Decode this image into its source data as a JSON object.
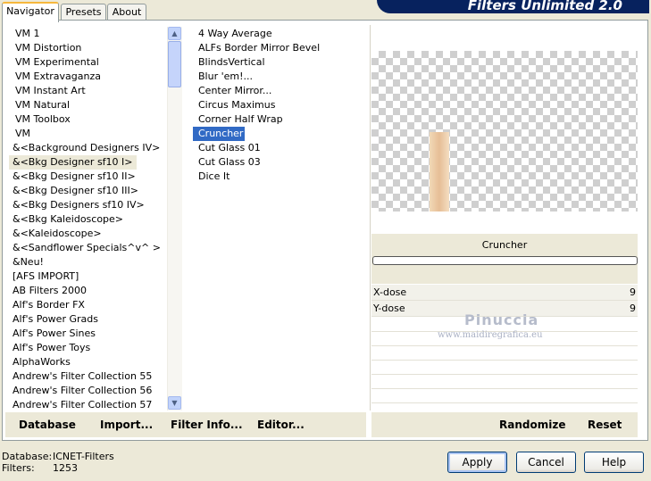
{
  "tabs": [
    {
      "label": "Navigator"
    },
    {
      "label": "Presets"
    },
    {
      "label": "About"
    }
  ],
  "header": {
    "title": "Filters Unlimited 2.0"
  },
  "categories": [
    "VM 1",
    "VM Distortion",
    "VM Experimental",
    "VM Extravaganza",
    "VM Instant Art",
    "VM Natural",
    "VM Toolbox",
    "VM",
    "&<Background Designers IV>",
    "&<Bkg Designer sf10 I>",
    "&<Bkg Designer sf10 II>",
    "&<Bkg Designer sf10 III>",
    "&<Bkg Designers sf10 IV>",
    "&<Bkg Kaleidoscope>",
    "&<Kaleidoscope>",
    "&<Sandflower Specials^v^ >",
    "&Neu!",
    "[AFS IMPORT]",
    "AB Filters 2000",
    "Alf's Border FX",
    "Alf's Power Grads",
    "Alf's Power Sines",
    "Alf's Power Toys",
    "AlphaWorks",
    "Andrew's Filter Collection 55",
    "Andrew's Filter Collection 56",
    "Andrew's Filter Collection 57"
  ],
  "filters": [
    "4 Way Average",
    "ALFs Border Mirror Bevel",
    "BlindsVertical",
    "Blur 'em!...",
    "Center Mirror...",
    "Circus Maximus",
    "Corner Half Wrap",
    "Cruncher",
    "Cut Glass 01",
    "Cut Glass 03",
    "Dice It"
  ],
  "selected_filter": "Cruncher",
  "params": [
    {
      "label": "X-dose",
      "value": "9"
    },
    {
      "label": "Y-dose",
      "value": "9"
    }
  ],
  "watermark": {
    "name": "Pinuccia",
    "url": "www.maidiregrafica.eu"
  },
  "bottom_left_buttons": {
    "database": "Database",
    "import": "Import...",
    "filter_info": "Filter Info...",
    "editor": "Editor..."
  },
  "bottom_right_buttons": {
    "randomize": "Randomize",
    "reset": "Reset"
  },
  "status": {
    "database_label": "Database:",
    "database_value": "ICNET-Filters",
    "filters_label": "Filters:",
    "filters_value": "1253"
  },
  "dialog_buttons": {
    "apply": "Apply",
    "cancel": "Cancel",
    "help": "Help"
  },
  "colors": {
    "selection": "#316ac5",
    "banner": "#07225e",
    "dialog_bg": "#ece9d8"
  }
}
